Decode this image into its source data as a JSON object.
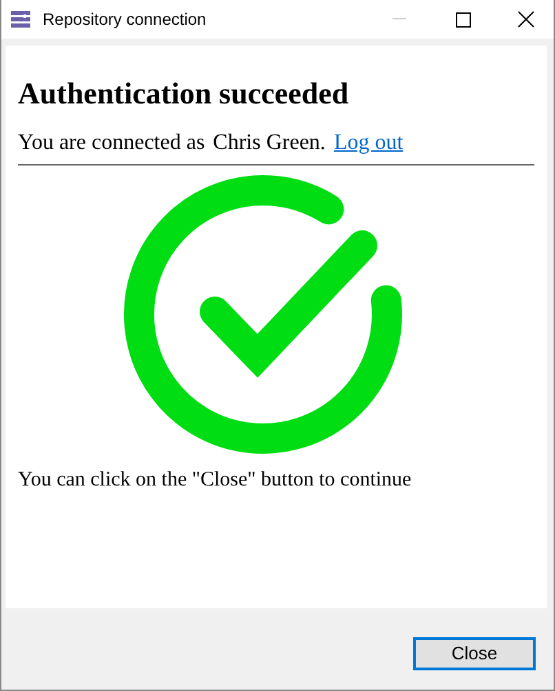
{
  "window": {
    "title": "Repository connection"
  },
  "heading": "Authentication succeeded",
  "connection": {
    "prefix": "You are connected as",
    "user": "Chris Green.",
    "link": "Log out"
  },
  "hint": "You can click on the \"Close\" button to continue",
  "buttons": [
    {
      "label": "Close",
      "focused": true
    }
  ]
}
